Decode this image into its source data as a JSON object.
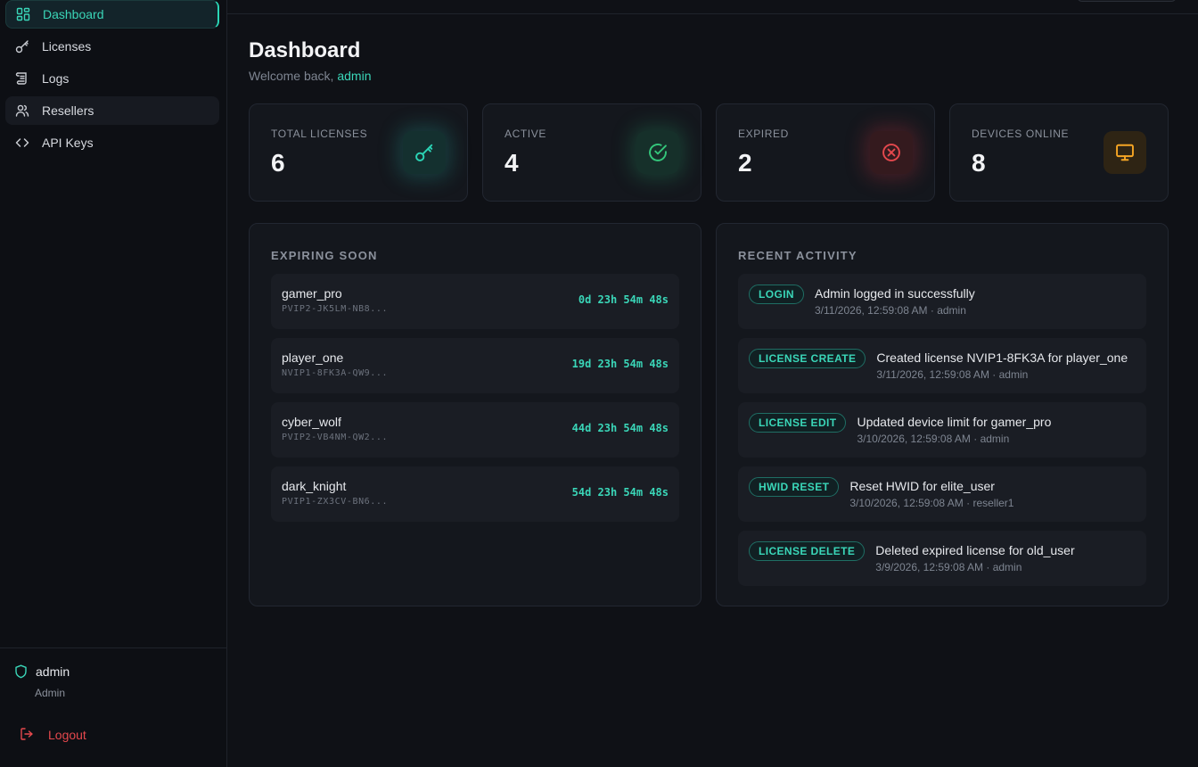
{
  "sidebar": {
    "items": [
      {
        "label": "Dashboard",
        "icon": "grid-icon",
        "active": true
      },
      {
        "label": "Licenses",
        "icon": "key-icon"
      },
      {
        "label": "Logs",
        "icon": "scroll-icon"
      },
      {
        "label": "Resellers",
        "icon": "users-icon"
      },
      {
        "label": "API Keys",
        "icon": "code-icon"
      }
    ],
    "user": {
      "name": "admin",
      "role": "Admin"
    },
    "logout_label": "Logout"
  },
  "header": {
    "title": "Dashboard",
    "welcome_prefix": "Welcome back, ",
    "welcome_user": "admin"
  },
  "stats": [
    {
      "label": "TOTAL LICENSES",
      "value": "6",
      "icon": "key-icon",
      "color": "#2bd5b6"
    },
    {
      "label": "ACTIVE",
      "value": "4",
      "icon": "check-circle-icon",
      "color": "#34c77b"
    },
    {
      "label": "EXPIRED",
      "value": "2",
      "icon": "x-circle-icon",
      "color": "#e5484d"
    },
    {
      "label": "DEVICES ONLINE",
      "value": "8",
      "icon": "monitor-icon",
      "color": "#f5a524"
    }
  ],
  "expiring": {
    "title": "EXPIRING SOON",
    "items": [
      {
        "name": "gamer_pro",
        "key": "PVIP2-JK5LM-NB8...",
        "time": "0d 23h 54m 48s"
      },
      {
        "name": "player_one",
        "key": "NVIP1-8FK3A-QW9...",
        "time": "19d 23h 54m 48s"
      },
      {
        "name": "cyber_wolf",
        "key": "PVIP2-VB4NM-QW2...",
        "time": "44d 23h 54m 48s"
      },
      {
        "name": "dark_knight",
        "key": "PVIP1-ZX3CV-BN6...",
        "time": "54d 23h 54m 48s"
      }
    ]
  },
  "activity": {
    "title": "RECENT ACTIVITY",
    "items": [
      {
        "badge": "LOGIN",
        "message": "Admin logged in successfully",
        "meta": "3/11/2026, 12:59:08 AM · admin"
      },
      {
        "badge": "LICENSE CREATE",
        "message": "Created license NVIP1-8FK3A for player_one",
        "meta": "3/11/2026, 12:59:08 AM · admin"
      },
      {
        "badge": "LICENSE EDIT",
        "message": "Updated device limit for gamer_pro",
        "meta": "3/10/2026, 12:59:08 AM · admin"
      },
      {
        "badge": "HWID RESET",
        "message": "Reset HWID for elite_user",
        "meta": "3/10/2026, 12:59:08 AM · reseller1"
      },
      {
        "badge": "LICENSE DELETE",
        "message": "Deleted expired license for old_user",
        "meta": "3/9/2026, 12:59:08 AM · admin"
      }
    ]
  },
  "colors": {
    "accent": "#2bd5b6",
    "danger": "#e5484d",
    "warning": "#f5a524",
    "success": "#34c77b"
  }
}
